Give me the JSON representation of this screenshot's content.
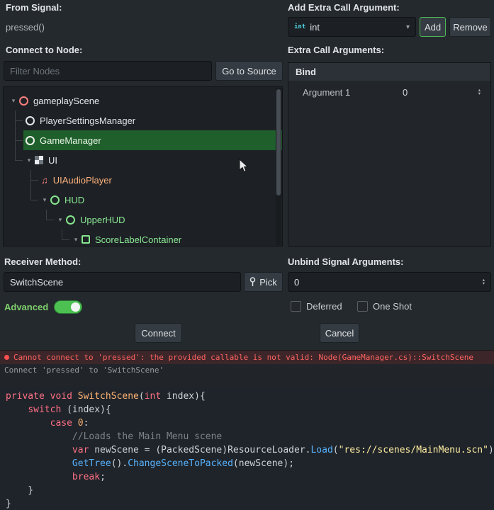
{
  "icons": {
    "chevron_down": "▾",
    "tree_arrow": "▾",
    "spin_up": "▴",
    "spin_down": "▾",
    "note": "♫"
  },
  "from_signal": {
    "label": "From Signal:",
    "value": "pressed()"
  },
  "add_arg": {
    "label": "Add Extra Call Argument:",
    "type_icon": "int",
    "type_value": "int",
    "add": "Add",
    "remove": "Remove"
  },
  "connect_node": {
    "label": "Connect to Node:",
    "filter_placeholder": "Filter Nodes",
    "go_to_source": "Go to Source"
  },
  "tree": {
    "rows": [
      {
        "name": "gameplayScene",
        "depth": 0,
        "arrow": true,
        "icon": "circle",
        "icon_color": "#fc7f7f",
        "color": "#e8ebee",
        "selected": false
      },
      {
        "name": "PlayerSettingsManager",
        "depth": 1,
        "arrow": false,
        "icon": "circle",
        "icon_color": "#e4e7ea",
        "color": "#dfe3e7",
        "selected": false
      },
      {
        "name": "GameManager",
        "depth": 1,
        "arrow": false,
        "icon": "circle",
        "icon_color": "#eef3ee",
        "color": "#e8f5e6",
        "selected": true
      },
      {
        "name": "UI",
        "depth": 1,
        "arrow": true,
        "icon": "checker",
        "icon_color": "#d8dadd",
        "color": "#e8ebee",
        "selected": false
      },
      {
        "name": "UIAudioPlayer",
        "depth": 2,
        "arrow": false,
        "icon": "note",
        "icon_color": "#fc7f7f",
        "color": "#ffb27c",
        "selected": false
      },
      {
        "name": "HUD",
        "depth": 2,
        "arrow": true,
        "icon": "circle",
        "icon_color": "#86e58f",
        "color": "#8ce996",
        "selected": false
      },
      {
        "name": "UpperHUD",
        "depth": 3,
        "arrow": true,
        "icon": "circle",
        "icon_color": "#86e58f",
        "color": "#8ce996",
        "selected": false
      },
      {
        "name": "ScoreLabelContainer",
        "depth": 4,
        "arrow": true,
        "icon": "square",
        "icon_color": "#86e58f",
        "color": "#8ce996",
        "selected": false
      }
    ]
  },
  "extra_args": {
    "label": "Extra Call Arguments:",
    "bind_header": "Bind",
    "rows": [
      {
        "name": "Argument 1",
        "value": "0"
      }
    ]
  },
  "receiver": {
    "label": "Receiver Method:",
    "value": "SwitchScene",
    "pick": "Pick"
  },
  "advanced": {
    "label": "Advanced",
    "on": true
  },
  "unbind": {
    "label": "Unbind Signal Arguments:",
    "value": "0"
  },
  "checkboxes": {
    "deferred": "Deferred",
    "one_shot": "One Shot"
  },
  "actions": {
    "connect": "Connect",
    "cancel": "Cancel"
  },
  "log": {
    "error": "Cannot connect to 'pressed': the provided callable is not valid: Node(GameManager.cs)::SwitchScene",
    "info": "Connect 'pressed' to 'SwitchScene'"
  },
  "code": {
    "lines": [
      [
        {
          "t": "private void ",
          "c": "kw"
        },
        {
          "t": "SwitchScene",
          "c": "num"
        },
        {
          "t": "(",
          "c": "pl"
        },
        {
          "t": "int",
          "c": "kw"
        },
        {
          "t": " index){",
          "c": "pl"
        }
      ],
      [
        {
          "t": "    ",
          "c": "pl"
        },
        {
          "t": "switch ",
          "c": "kw"
        },
        {
          "t": "(index){",
          "c": "pl"
        }
      ],
      [
        {
          "t": "        ",
          "c": "pl"
        },
        {
          "t": "case ",
          "c": "kw"
        },
        {
          "t": "0",
          "c": "num"
        },
        {
          "t": ":",
          "c": "pl"
        }
      ],
      [
        {
          "t": "            ",
          "c": "pl"
        },
        {
          "t": "//Loads the Main Menu scene",
          "c": "cm"
        }
      ],
      [
        {
          "t": "            ",
          "c": "pl"
        },
        {
          "t": "var",
          "c": "kw"
        },
        {
          "t": " newScene = (PackedScene)ResourceLoader.",
          "c": "pl"
        },
        {
          "t": "Load",
          "c": "fn"
        },
        {
          "t": "(",
          "c": "pl"
        },
        {
          "t": "\"res://scenes/MainMenu.scn\"",
          "c": "str"
        },
        {
          "t": ");",
          "c": "pl"
        }
      ],
      [
        {
          "t": "            ",
          "c": "pl"
        },
        {
          "t": "GetTree",
          "c": "fn"
        },
        {
          "t": "().",
          "c": "pl"
        },
        {
          "t": "ChangeSceneToPacked",
          "c": "fn"
        },
        {
          "t": "(newScene);",
          "c": "pl"
        }
      ],
      [
        {
          "t": "            ",
          "c": "pl"
        },
        {
          "t": "break",
          "c": "kw"
        },
        {
          "t": ";",
          "c": "pl"
        }
      ],
      [
        {
          "t": "    }",
          "c": "pl"
        }
      ],
      [
        {
          "t": "}",
          "c": "pl"
        }
      ]
    ]
  }
}
